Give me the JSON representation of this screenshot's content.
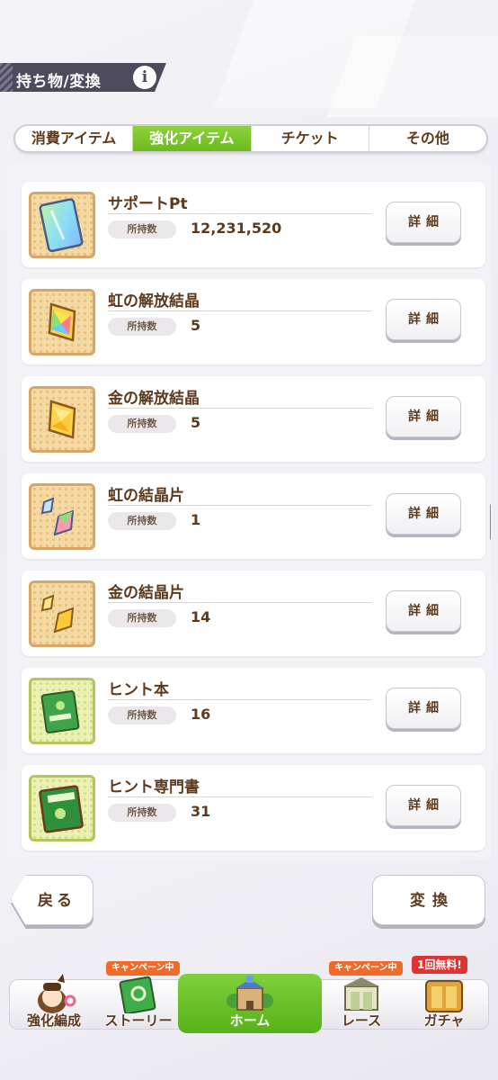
{
  "header": {
    "title": "持ち物/変換",
    "info_icon": "info-icon"
  },
  "tabs": [
    {
      "label": "消費アイテム",
      "active": false
    },
    {
      "label": "強化アイテム",
      "active": true
    },
    {
      "label": "チケット",
      "active": false
    },
    {
      "label": "その他",
      "active": false
    }
  ],
  "items": [
    {
      "name": "サポートPt",
      "owned_label": "所持数",
      "owned": "12,231,520",
      "button": "詳細",
      "icon": "support-pt-card-icon"
    },
    {
      "name": "虹の解放結晶",
      "owned_label": "所持数",
      "owned": "5",
      "button": "詳細",
      "icon": "rainbow-crystal-icon"
    },
    {
      "name": "金の解放結晶",
      "owned_label": "所持数",
      "owned": "5",
      "button": "詳細",
      "icon": "gold-crystal-icon"
    },
    {
      "name": "虹の結晶片",
      "owned_label": "所持数",
      "owned": "1",
      "button": "詳細",
      "icon": "rainbow-shard-icon"
    },
    {
      "name": "金の結晶片",
      "owned_label": "所持数",
      "owned": "14",
      "button": "詳細",
      "icon": "gold-shard-icon"
    },
    {
      "name": "ヒント本",
      "owned_label": "所持数",
      "owned": "16",
      "button": "詳細",
      "icon": "hint-book-icon"
    },
    {
      "name": "ヒント専門書",
      "owned_label": "所持数",
      "owned": "31",
      "button": "詳細",
      "icon": "hint-tome-icon"
    }
  ],
  "buttons": {
    "back": "戻る",
    "convert": "変換"
  },
  "nav": [
    {
      "label": "強化編成",
      "badge": ""
    },
    {
      "label": "ストーリー",
      "badge": "キャンペーン中"
    },
    {
      "label": "ホーム",
      "badge": ""
    },
    {
      "label": "レース",
      "badge": "キャンペーン中"
    },
    {
      "label": "ガチャ",
      "badge": "1回無料!"
    }
  ],
  "colors": {
    "accent_green": "#6cbb1f",
    "text_brown": "#5b3a1e",
    "header_dark": "#4d4a5c"
  }
}
